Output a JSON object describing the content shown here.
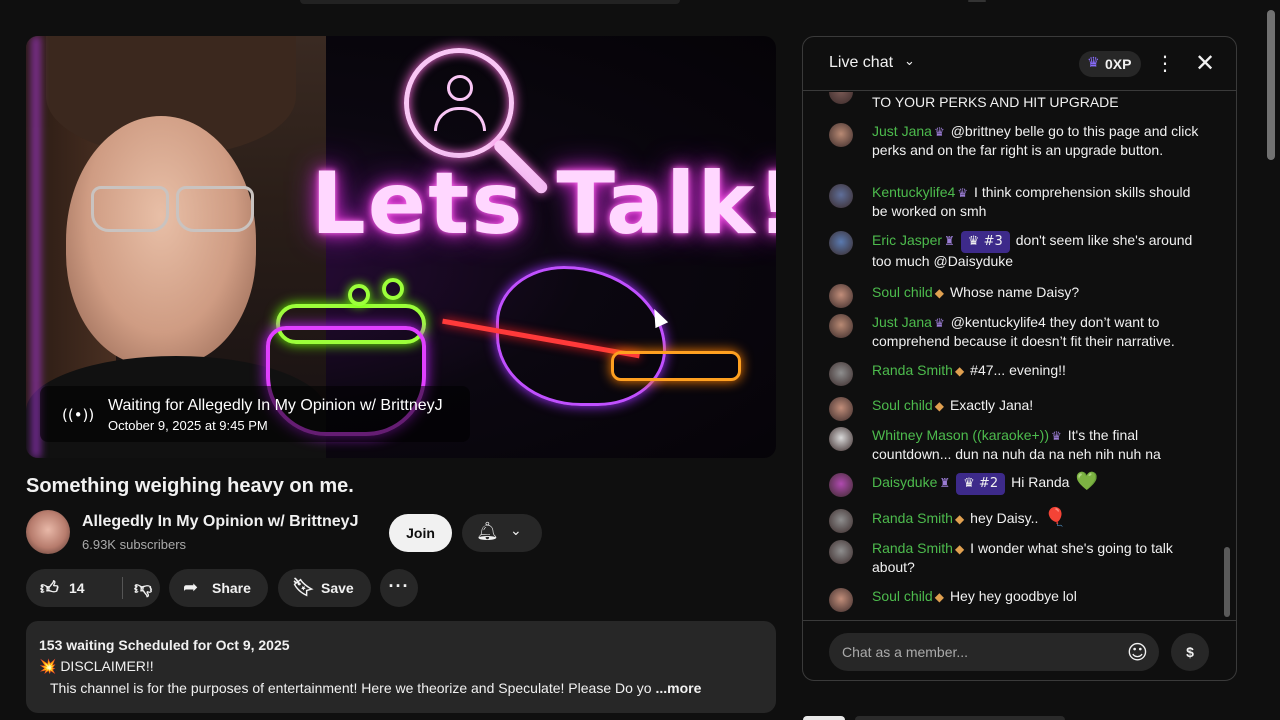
{
  "player": {
    "thumbnail_text": "Lets Talk!",
    "waiting_title": "Waiting for Allegedly In My Opinion w/ BrittneyJ",
    "waiting_date": "October 9, 2025 at 9:45 PM",
    "live_icon": "broadcast-icon"
  },
  "video": {
    "title": "Something weighing heavy on me."
  },
  "channel": {
    "name": "Allegedly In My Opinion w/ BrittneyJ",
    "subscribers": "6.93K subscribers",
    "join_label": "Join"
  },
  "actions": {
    "like_count": "14",
    "share_label": "Share",
    "save_label": "Save"
  },
  "description": {
    "stats": "153 waiting  Scheduled for Oct 9, 2025",
    "line1": "💥 DISCLAIMER!!",
    "line2": "This channel is for the purposes of entertainment!  Here we theorize and Speculate!  Please Do yo",
    "more": " ...more"
  },
  "chat": {
    "title": "Live chat",
    "xp": "0XP",
    "input_placeholder": "Chat as a member...",
    "colors": {
      "author": "#4dbb4d",
      "member_badge": "#3d2a8a"
    },
    "messages": [
      {
        "author": "",
        "badge": "",
        "member": "",
        "text": "TO YOUR PERKS AND HIT UPGRADE",
        "emoji": ""
      },
      {
        "author": "Just Jana",
        "badge": "♛",
        "member": "",
        "text": "@brittney belle go to this page and click perks and on the far right is an upgrade button.",
        "emoji": ""
      },
      {
        "author": "Kentuckylife4",
        "badge": "♛",
        "member": "",
        "text": "I think comprehension skills should be worked on smh",
        "emoji": ""
      },
      {
        "author": "Eric Jasper",
        "badge": "♜",
        "member": "♛ #3",
        "text": "don't seem like she's around too much @Daisyduke",
        "emoji": ""
      },
      {
        "author": "Soul child",
        "badge": "◆",
        "member": "",
        "text": "Whose name Daisy?",
        "emoji": ""
      },
      {
        "author": "Just Jana",
        "badge": "♛",
        "member": "",
        "text": "@kentuckylife4 they don’t want to comprehend because it doesn’t fit their narrative.",
        "emoji": ""
      },
      {
        "author": "Randa Smith",
        "badge": "◆",
        "member": "",
        "text": "#47... evening!!",
        "emoji": ""
      },
      {
        "author": "Soul child",
        "badge": "◆",
        "member": "",
        "text": "Exactly Jana!",
        "emoji": ""
      },
      {
        "author": "Whitney Mason ((karaoke+))",
        "badge": "♛",
        "member": "",
        "text": "It's the final countdown... dun na nuh da na neh nih nuh na",
        "emoji": ""
      },
      {
        "author": "Daisyduke",
        "badge": "♜",
        "member": "♛ #2",
        "text": "Hi Randa",
        "emoji": "💚"
      },
      {
        "author": "Randa Smith",
        "badge": "◆",
        "member": "",
        "text": "hey Daisy..",
        "emoji": "🎈"
      },
      {
        "author": "Randa Smith",
        "badge": "◆",
        "member": "",
        "text": "I wonder what she's going to talk about?",
        "emoji": ""
      },
      {
        "author": "Soul child",
        "badge": "◆",
        "member": "",
        "text": "Hey hey goodbye lol",
        "emoji": ""
      }
    ]
  }
}
